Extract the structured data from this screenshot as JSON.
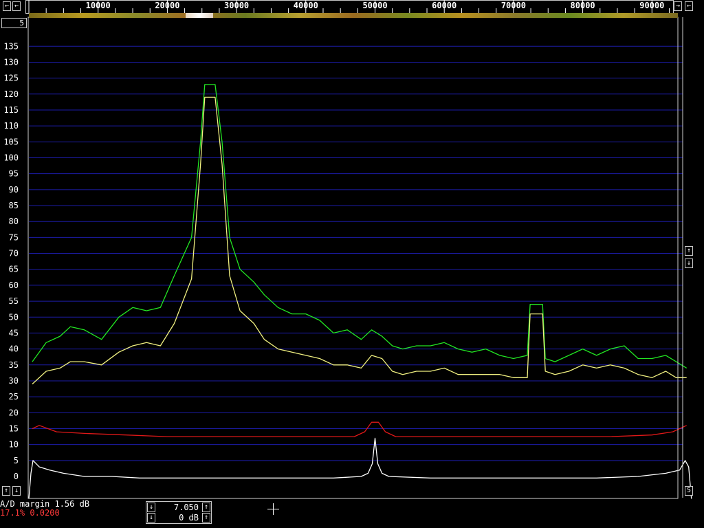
{
  "top_ruler": {
    "ticks": [
      "10000",
      "20000",
      "30000",
      "40000",
      "50000",
      "60000",
      "70000",
      "80000",
      "90000"
    ],
    "left_scroll_icon": "left-arrow-icon",
    "right_scroll_icons": [
      "right-arrow-icon",
      "left-arrow-icon"
    ]
  },
  "corner_label": "5",
  "right_controls": {
    "up_icon": "up-arrow-icon",
    "down_icon": "down-arrow-icon"
  },
  "bottom_right_label": "5",
  "status": {
    "ad_margin": "A/D margin 1.56 dB",
    "percent_line": "17.1% 0.0200"
  },
  "value_box": {
    "value": "7.050",
    "db": "0 dB"
  },
  "colors": {
    "background": "#000000",
    "grid": "#1c1ca8",
    "peak_hold": "#22e622",
    "average": "#f0f080",
    "noise_floor": "#e01818",
    "spectrum": "#ffffff",
    "status_red": "#ff3a3a"
  },
  "chart_data": {
    "type": "line",
    "x_ticks": [
      10000,
      20000,
      30000,
      40000,
      50000,
      60000,
      70000,
      80000,
      90000
    ],
    "xlim": [
      0,
      96000
    ],
    "y_ticks": [
      0,
      5,
      10,
      15,
      20,
      25,
      30,
      35,
      40,
      45,
      50,
      55,
      60,
      65,
      70,
      75,
      80,
      85,
      90,
      95,
      100,
      105,
      110,
      115,
      120,
      125,
      130,
      135
    ],
    "ylim": [
      -7,
      139
    ],
    "grid": true,
    "series": [
      {
        "color": "#22e622",
        "points": [
          [
            500,
            36
          ],
          [
            2500,
            42
          ],
          [
            4500,
            44
          ],
          [
            6000,
            47
          ],
          [
            8000,
            46
          ],
          [
            10500,
            43
          ],
          [
            13000,
            50
          ],
          [
            15000,
            53
          ],
          [
            17000,
            52
          ],
          [
            19000,
            53
          ],
          [
            21000,
            63
          ],
          [
            23500,
            75
          ],
          [
            24800,
            105
          ],
          [
            25400,
            123
          ],
          [
            26900,
            123
          ],
          [
            27900,
            105
          ],
          [
            29000,
            75
          ],
          [
            30500,
            65
          ],
          [
            32500,
            61
          ],
          [
            34000,
            57
          ],
          [
            36000,
            53
          ],
          [
            38000,
            51
          ],
          [
            40000,
            51
          ],
          [
            42000,
            49
          ],
          [
            44000,
            45
          ],
          [
            46000,
            46
          ],
          [
            48000,
            43
          ],
          [
            49500,
            46
          ],
          [
            51000,
            44
          ],
          [
            52500,
            41
          ],
          [
            54000,
            40
          ],
          [
            56000,
            41
          ],
          [
            58000,
            41
          ],
          [
            60000,
            42
          ],
          [
            62000,
            40
          ],
          [
            64000,
            39
          ],
          [
            66000,
            40
          ],
          [
            68000,
            38
          ],
          [
            70000,
            37
          ],
          [
            72000,
            38
          ],
          [
            72400,
            54
          ],
          [
            74200,
            54
          ],
          [
            74600,
            37
          ],
          [
            76000,
            36
          ],
          [
            78000,
            38
          ],
          [
            80000,
            40
          ],
          [
            82000,
            38
          ],
          [
            84000,
            40
          ],
          [
            86000,
            41
          ],
          [
            88000,
            37
          ],
          [
            90000,
            37
          ],
          [
            92000,
            38
          ],
          [
            93500,
            36
          ],
          [
            95000,
            34
          ]
        ]
      },
      {
        "color": "#f0f080",
        "points": [
          [
            500,
            29
          ],
          [
            2500,
            33
          ],
          [
            4500,
            34
          ],
          [
            6000,
            36
          ],
          [
            8000,
            36
          ],
          [
            10500,
            35
          ],
          [
            13000,
            39
          ],
          [
            15000,
            41
          ],
          [
            17000,
            42
          ],
          [
            19000,
            41
          ],
          [
            21000,
            48
          ],
          [
            23500,
            62
          ],
          [
            24800,
            98
          ],
          [
            25400,
            119
          ],
          [
            26900,
            119
          ],
          [
            27900,
            98
          ],
          [
            29000,
            63
          ],
          [
            30500,
            52
          ],
          [
            32500,
            48
          ],
          [
            34000,
            43
          ],
          [
            36000,
            40
          ],
          [
            38000,
            39
          ],
          [
            40000,
            38
          ],
          [
            42000,
            37
          ],
          [
            44000,
            35
          ],
          [
            46000,
            35
          ],
          [
            48000,
            34
          ],
          [
            49500,
            38
          ],
          [
            51000,
            37
          ],
          [
            52500,
            33
          ],
          [
            54000,
            32
          ],
          [
            56000,
            33
          ],
          [
            58000,
            33
          ],
          [
            60000,
            34
          ],
          [
            62000,
            32
          ],
          [
            64000,
            32
          ],
          [
            66000,
            32
          ],
          [
            68000,
            32
          ],
          [
            70000,
            31
          ],
          [
            72000,
            31
          ],
          [
            72400,
            51
          ],
          [
            74200,
            51
          ],
          [
            74600,
            33
          ],
          [
            76000,
            32
          ],
          [
            78000,
            33
          ],
          [
            80000,
            35
          ],
          [
            82000,
            34
          ],
          [
            84000,
            35
          ],
          [
            86000,
            34
          ],
          [
            88000,
            32
          ],
          [
            90000,
            31
          ],
          [
            92000,
            33
          ],
          [
            93500,
            31
          ],
          [
            95000,
            31
          ]
        ]
      },
      {
        "color": "#e01818",
        "points": [
          [
            500,
            15
          ],
          [
            1500,
            16
          ],
          [
            4000,
            14
          ],
          [
            8000,
            13.5
          ],
          [
            14000,
            13
          ],
          [
            20000,
            12.5
          ],
          [
            28000,
            12.5
          ],
          [
            36000,
            12.5
          ],
          [
            44000,
            12.5
          ],
          [
            47000,
            12.5
          ],
          [
            48500,
            14
          ],
          [
            49500,
            17
          ],
          [
            50500,
            17
          ],
          [
            51500,
            14
          ],
          [
            53000,
            12.5
          ],
          [
            60000,
            12.5
          ],
          [
            68000,
            12.5
          ],
          [
            76000,
            12.5
          ],
          [
            84000,
            12.5
          ],
          [
            90000,
            13
          ],
          [
            93000,
            14
          ],
          [
            95000,
            16
          ]
        ]
      },
      {
        "color": "#ffffff",
        "points": [
          [
            0,
            -7
          ],
          [
            300,
            1
          ],
          [
            600,
            5
          ],
          [
            1500,
            3
          ],
          [
            3000,
            2
          ],
          [
            5000,
            1
          ],
          [
            8000,
            0
          ],
          [
            12000,
            0
          ],
          [
            16000,
            -0.5
          ],
          [
            20000,
            -0.5
          ],
          [
            26000,
            -0.5
          ],
          [
            32000,
            -0.5
          ],
          [
            38000,
            -0.5
          ],
          [
            44000,
            -0.5
          ],
          [
            48000,
            0
          ],
          [
            49000,
            1
          ],
          [
            49600,
            4
          ],
          [
            50000,
            12
          ],
          [
            50400,
            4
          ],
          [
            51000,
            1
          ],
          [
            52000,
            0
          ],
          [
            58000,
            -0.5
          ],
          [
            64000,
            -0.5
          ],
          [
            70000,
            -0.5
          ],
          [
            76000,
            -0.5
          ],
          [
            82000,
            -0.5
          ],
          [
            88000,
            0
          ],
          [
            92000,
            1
          ],
          [
            94000,
            2
          ],
          [
            94800,
            5
          ],
          [
            95300,
            3
          ],
          [
            95700,
            -7
          ]
        ]
      }
    ]
  }
}
